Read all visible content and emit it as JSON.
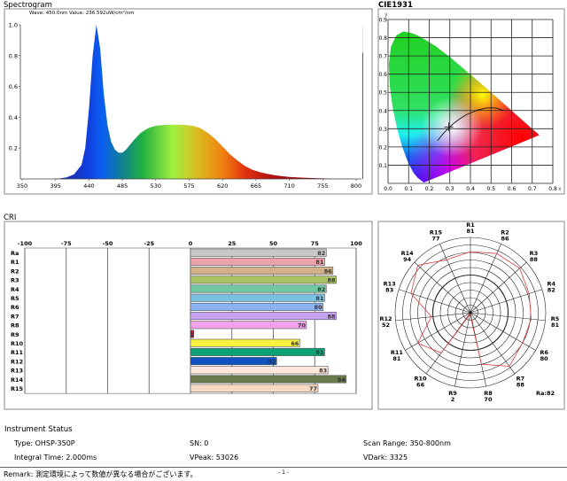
{
  "titles": {
    "spectrogram": "Spectrogram",
    "cie": "CIE1931",
    "cri": "CRI"
  },
  "chart_data": [
    {
      "type": "area",
      "title": "Spectrogram",
      "annotation": "Wave: 450.0nm Value: 236.592uW/cm²/nm",
      "xlim": [
        350,
        800
      ],
      "ylim": [
        0,
        1.0
      ],
      "x_ticks": [
        "350",
        "395",
        "440",
        "485",
        "530",
        "575",
        "620",
        "665",
        "710",
        "755",
        "800"
      ],
      "y_ticks": [
        "0.2",
        "0.4",
        "0.6",
        "0.8",
        "1.0"
      ],
      "x": [
        350,
        360,
        370,
        380,
        390,
        400,
        410,
        420,
        430,
        435,
        440,
        445,
        450,
        455,
        460,
        465,
        470,
        475,
        480,
        485,
        490,
        500,
        510,
        520,
        530,
        540,
        550,
        560,
        570,
        580,
        590,
        600,
        610,
        620,
        630,
        640,
        650,
        660,
        670,
        680,
        690,
        700,
        710,
        720,
        730,
        740,
        750,
        760,
        770,
        780,
        790,
        800
      ],
      "values": [
        0,
        0,
        0,
        0,
        0,
        0.003,
        0.01,
        0.03,
        0.09,
        0.2,
        0.45,
        0.8,
        1.0,
        0.85,
        0.55,
        0.35,
        0.24,
        0.19,
        0.17,
        0.17,
        0.19,
        0.25,
        0.3,
        0.33,
        0.345,
        0.35,
        0.352,
        0.352,
        0.35,
        0.345,
        0.33,
        0.3,
        0.26,
        0.21,
        0.16,
        0.12,
        0.085,
        0.06,
        0.045,
        0.033,
        0.025,
        0.018,
        0.013,
        0.01,
        0.008,
        0.006,
        0.004,
        0.003,
        0.002,
        0.001,
        0.001,
        0
      ],
      "marker_line_color": "#d03030"
    },
    {
      "type": "scatter",
      "title": "CIE1931",
      "xlabel": "x",
      "ylabel": "y",
      "xlim": [
        0,
        0.8
      ],
      "ylim": [
        0,
        0.9
      ],
      "x_ticks": [
        "0.0",
        "0.1",
        "0.2",
        "0.3",
        "0.4",
        "0.5",
        "0.6",
        "0.7",
        "0.8"
      ],
      "y_ticks": [
        "0.1",
        "0.2",
        "0.3",
        "0.4",
        "0.5",
        "0.6",
        "0.7",
        "0.8",
        "0.9"
      ],
      "point": [
        0.295,
        0.31
      ],
      "grid": true
    },
    {
      "type": "bar",
      "title": "CRI",
      "orientation": "horizontal",
      "xlim": [
        -100,
        100
      ],
      "x_ticks": [
        "-100",
        "-75",
        "-50",
        "-25",
        "0",
        "25",
        "50",
        "75",
        "100"
      ],
      "categories": [
        "Ra",
        "R1",
        "R2",
        "R3",
        "R4",
        "R5",
        "R6",
        "R7",
        "R8",
        "R9",
        "R10",
        "R11",
        "R12",
        "R13",
        "R14",
        "R15"
      ],
      "values": [
        82,
        81,
        86,
        88,
        82,
        81,
        80,
        88,
        70,
        2,
        66,
        81,
        52,
        83,
        94,
        77
      ],
      "colors": [
        "#c8c8c8",
        "#eba2aa",
        "#d2b088",
        "#a8c462",
        "#70c8a0",
        "#7ac0e0",
        "#8ab2f2",
        "#c8a2f2",
        "#f0a2ea",
        "#d01040",
        "#f8f040",
        "#10a078",
        "#1052c0",
        "#fde6da",
        "#6a7a4a",
        "#f8dac4"
      ]
    },
    {
      "type": "radar",
      "categories": [
        "R1",
        "R2",
        "R3",
        "R4",
        "R5",
        "R6",
        "R7",
        "R8",
        "R9",
        "R10",
        "R11",
        "R12",
        "R13",
        "R14",
        "R15"
      ],
      "values": [
        81,
        86,
        88,
        82,
        81,
        80,
        88,
        70,
        2,
        66,
        81,
        52,
        83,
        94,
        77
      ],
      "rlim": [
        0,
        100
      ],
      "summary": "Ra:82",
      "line_color": "#e04040"
    }
  ],
  "instrument": {
    "title": "Instrument Status",
    "type": "Type: OHSP-350P",
    "sn": "SN: 0",
    "scan_range": "Scan Range: 350-800nm",
    "integral_time": "Integral Time: 2.000ms",
    "vpeak": "VPeak: 53026",
    "vdark": "VDark: 3325"
  },
  "footer": {
    "remark": "Remark: 測定環境によって数値が異なる場合がございます。",
    "page": "- 1 -"
  }
}
